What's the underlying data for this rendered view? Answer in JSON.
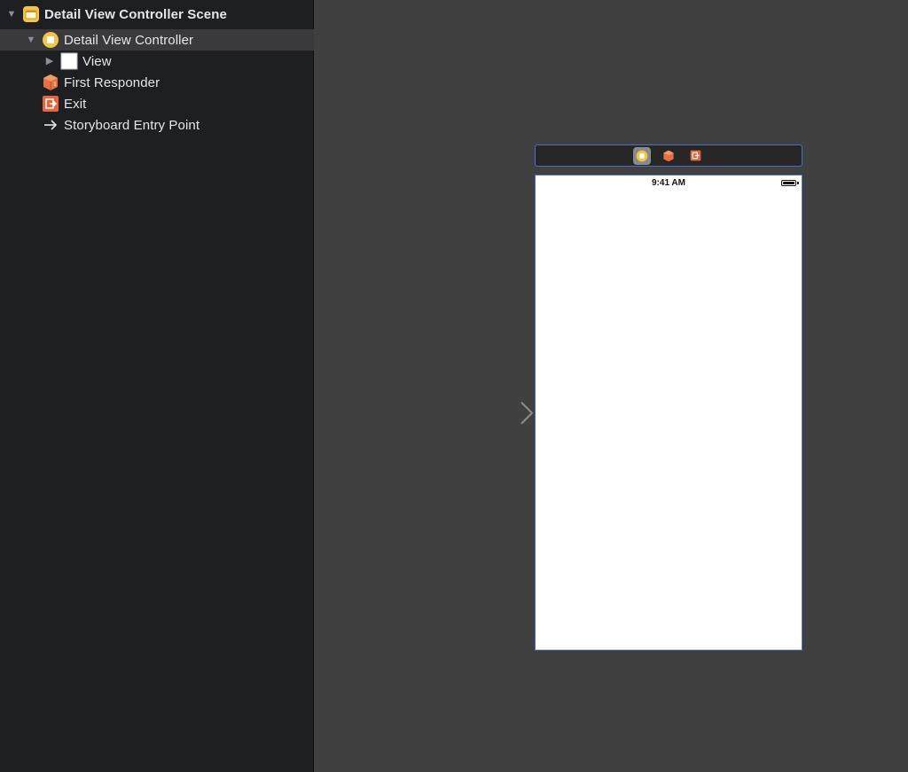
{
  "outline": {
    "items": [
      {
        "label": "Detail View Controller Scene",
        "icon": "storyboard-scene-icon",
        "expanded": true,
        "selected": false
      },
      {
        "label": "Detail View Controller",
        "icon": "view-controller-icon",
        "expanded": true,
        "selected": true
      },
      {
        "label": "View",
        "icon": "view-icon",
        "expanded": false,
        "selected": false
      },
      {
        "label": "First Responder",
        "icon": "first-responder-icon",
        "selected": false
      },
      {
        "label": "Exit",
        "icon": "exit-icon",
        "selected": false
      },
      {
        "label": "Storyboard Entry Point",
        "icon": "arrow-right-icon",
        "selected": false
      }
    ]
  },
  "canvas": {
    "dock_icons": [
      "view-controller-icon",
      "first-responder-icon",
      "exit-icon"
    ],
    "status_bar": {
      "time": "9:41 AM",
      "battery": 1.0
    }
  },
  "colors": {
    "selection_outline": "#4a6fc4",
    "scene_icon": "#f5c542",
    "responder_icon": "#e8703a",
    "exit_icon": "#e8643a"
  }
}
